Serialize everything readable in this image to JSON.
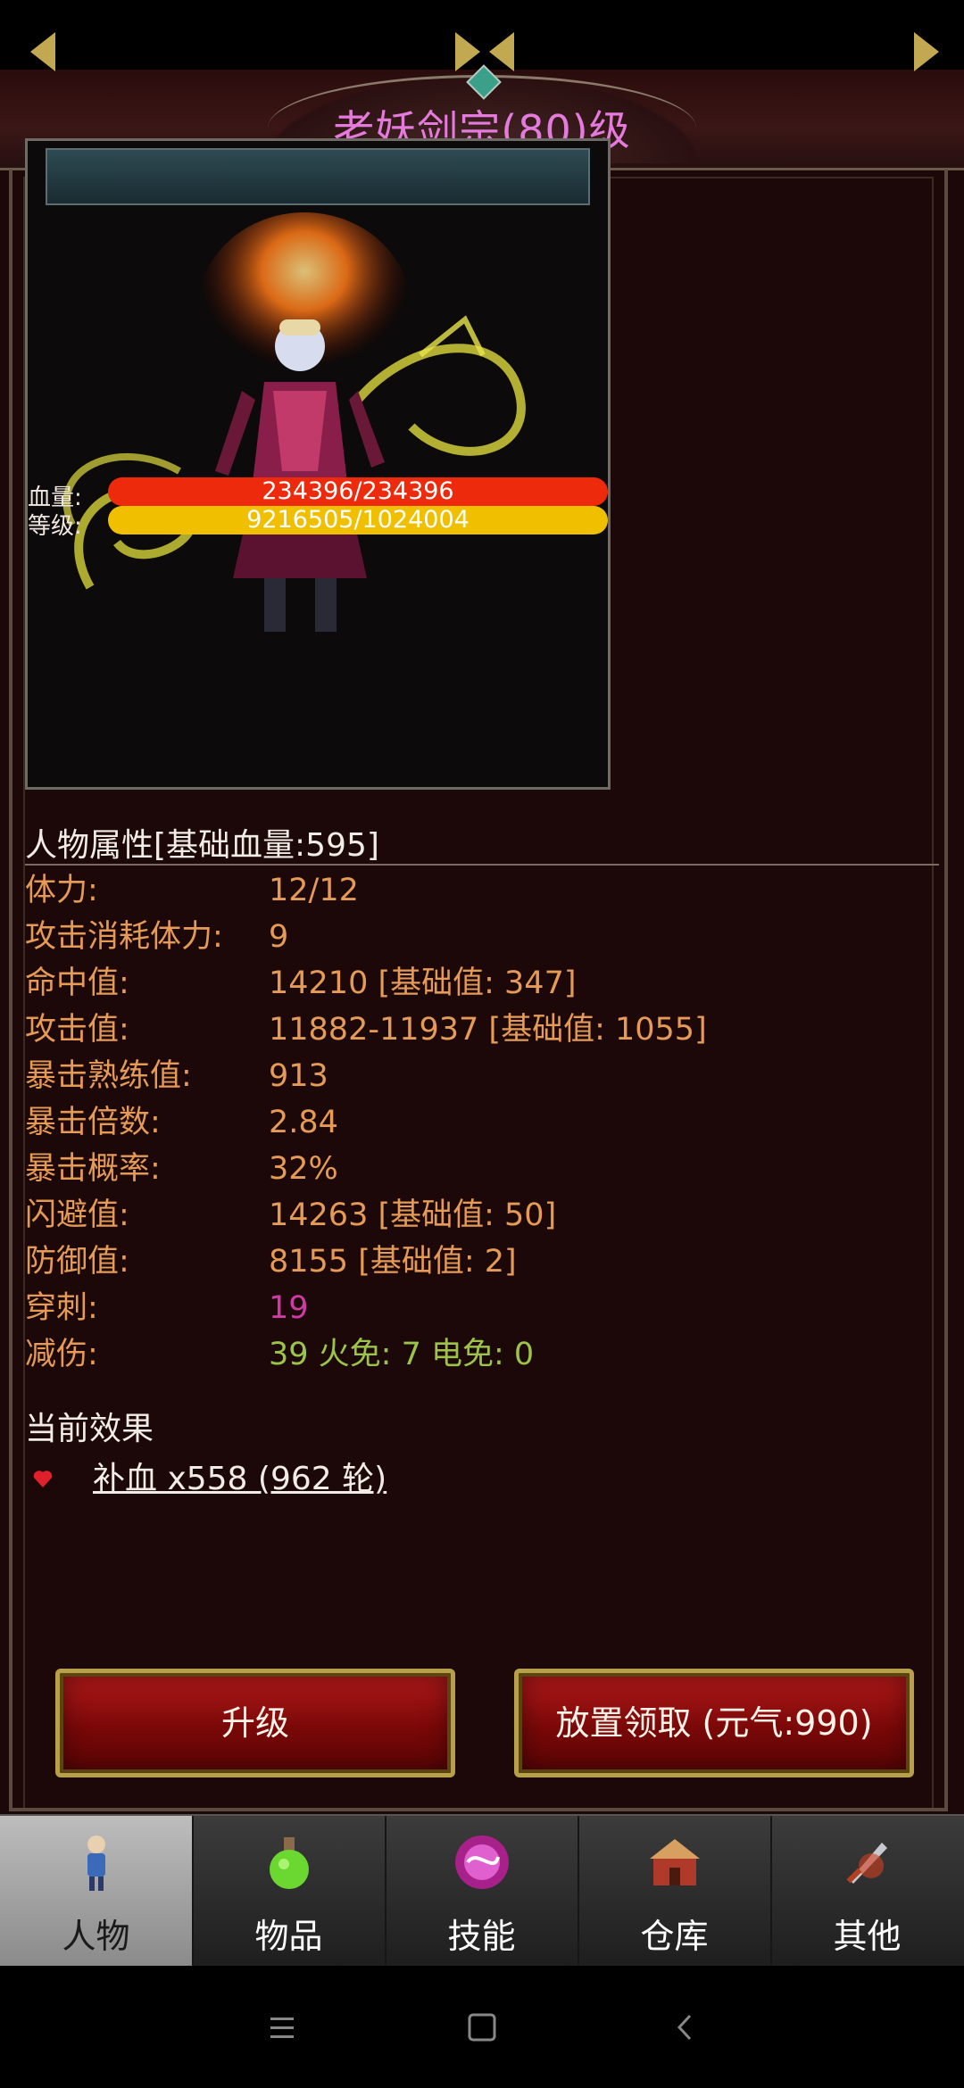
{
  "header": {
    "title": "老妖剑宗(80)级"
  },
  "portrait": {
    "hp_label": "血量:",
    "hp_text": "234396/234396",
    "hp_fraction": 1.0,
    "level_label": "等级:",
    "level_text": "9216505/1024004",
    "level_fraction": 1.0,
    "hp_color": "#ee2a0c",
    "level_color": "#f0c000"
  },
  "attributes": {
    "header": "人物属性[基础血量:595]",
    "rows": [
      {
        "key": "体力:",
        "value": "12/12"
      },
      {
        "key": "攻击消耗体力:",
        "value": "9"
      },
      {
        "key": "命中值:",
        "value": "14210 [基础值: 347]"
      },
      {
        "key": "攻击值:",
        "value": "11882-11937 [基础值: 1055]"
      },
      {
        "key": "暴击熟练值:",
        "value": "913"
      },
      {
        "key": "暴击倍数:",
        "value": "2.84"
      },
      {
        "key": "暴击概率:",
        "value": "32%"
      },
      {
        "key": "闪避值:",
        "value": "14263 [基础值: 50]"
      },
      {
        "key": "防御值:",
        "value": "8155 [基础值: 2]"
      },
      {
        "key": "穿刺:",
        "value": "19",
        "color": "#d03aa6"
      },
      {
        "key": "减伤:",
        "value": "39 火免: 7 电免: 0",
        "color": "#9cc448"
      }
    ]
  },
  "effects": {
    "title": "当前效果",
    "items": [
      {
        "icon": "heart-icon",
        "text": "补血 x558 (962 轮)"
      }
    ]
  },
  "buttons": {
    "upgrade": "升级",
    "collect": "放置领取 (元气:990)"
  },
  "tabs": [
    {
      "label": "人物",
      "icon": "character-icon",
      "active": true
    },
    {
      "label": "物品",
      "icon": "potion-icon",
      "active": false
    },
    {
      "label": "技能",
      "icon": "skill-orb-icon",
      "active": false
    },
    {
      "label": "仓库",
      "icon": "warehouse-icon",
      "active": false
    },
    {
      "label": "其他",
      "icon": "sword-icon",
      "active": false
    }
  ],
  "navigation": {
    "menu": "menu-icon",
    "home": "home-icon",
    "back": "back-icon"
  }
}
